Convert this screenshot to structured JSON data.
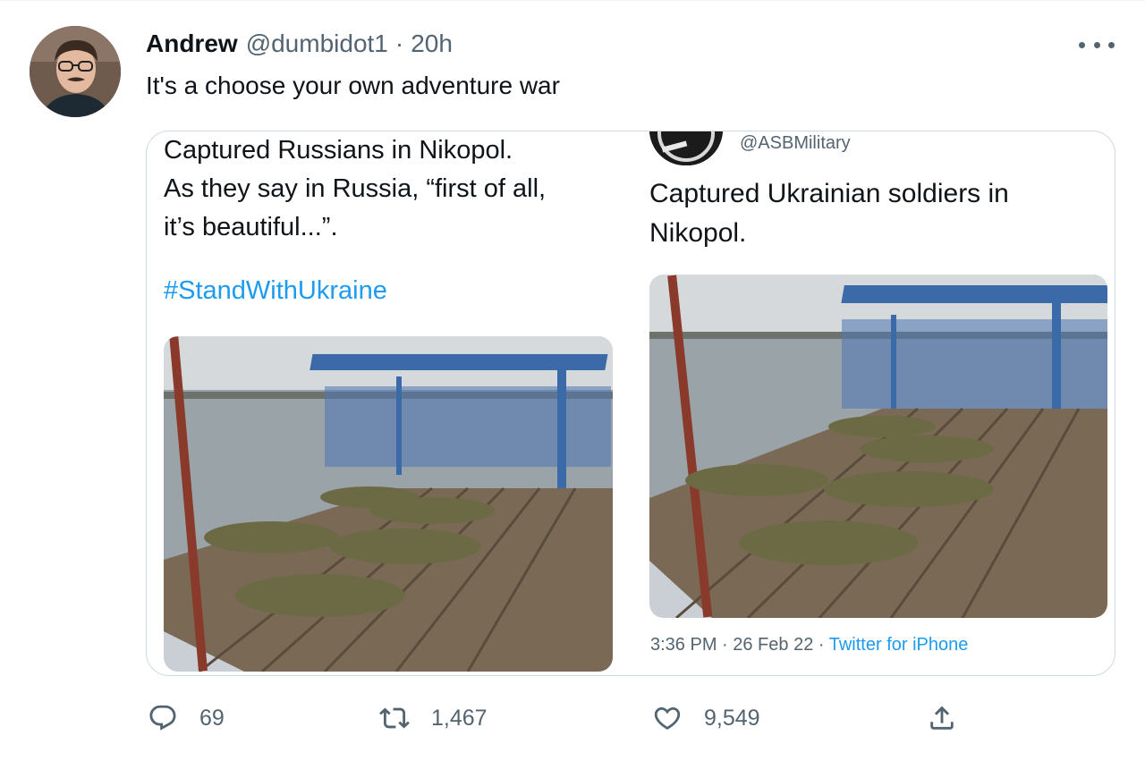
{
  "tweet": {
    "author_name": "Andrew",
    "author_handle": "@dumbidot1",
    "separator": "·",
    "time": "20h",
    "text": "It's a choose your own adventure war"
  },
  "quoted_left": {
    "lines": [
      "Captured Russians in Nikopol.",
      "As they say in Russia, “first of all,",
      "it’s beautiful...”."
    ],
    "hashtag": "#StandWithUkraine"
  },
  "quoted_right": {
    "handle": "@ASBMilitary",
    "lines": [
      "Captured Ukrainian soldiers in",
      "Nikopol."
    ],
    "timestamp": "3:36 PM · 26 Feb 22 · ",
    "source": "Twitter for iPhone"
  },
  "actions": {
    "replies": "69",
    "retweets": "1,467",
    "likes": "9,549"
  },
  "icons": {
    "reply": "speech-bubble-icon",
    "retweet": "retweet-arrows-icon",
    "like": "heart-icon",
    "share": "share-upload-icon",
    "more": "more-dots-icon"
  },
  "colors": {
    "accent": "#1d9bf0",
    "muted": "#536471",
    "text": "#0f1419"
  }
}
